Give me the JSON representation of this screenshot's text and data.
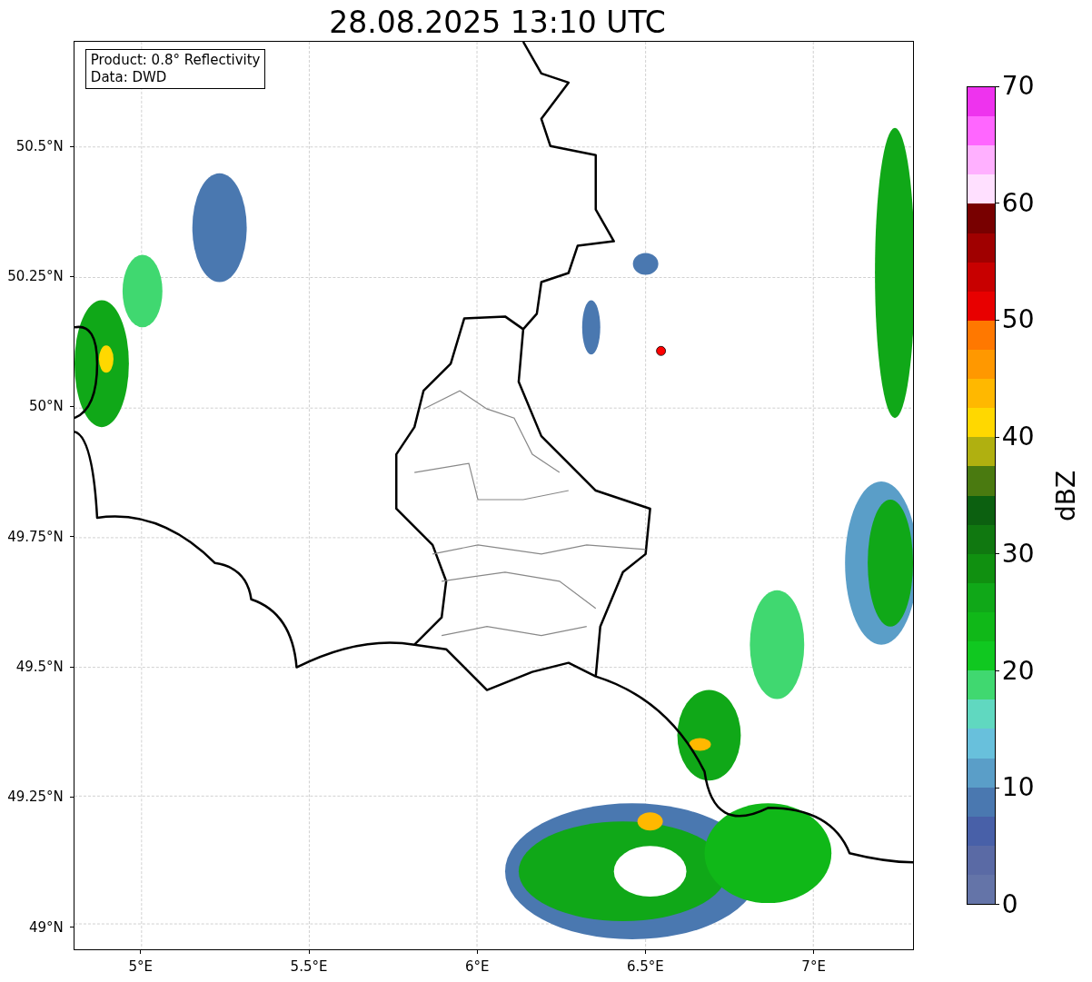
{
  "title": "28.08.2025 13:10 UTC",
  "info_box": {
    "lines": [
      "Product: 0.8° Reflectivity",
      "Data: DWD"
    ]
  },
  "map": {
    "y_ticks": [
      "50.5°N",
      "50.25°N",
      "50°N",
      "49.75°N",
      "49.5°N",
      "49.25°N",
      "49°N"
    ],
    "x_ticks": [
      "5°E",
      "5.5°E",
      "6°E",
      "6.5°E",
      "7°E"
    ]
  },
  "colorbar": {
    "label": "dBZ",
    "ticks": [
      "70",
      "60",
      "50",
      "40",
      "30",
      "20",
      "10",
      "0"
    ],
    "segments": [
      {
        "color": "#ee33ee"
      },
      {
        "color": "#ff66ff"
      },
      {
        "color": "#ffb0ff"
      },
      {
        "color": "#ffe0ff"
      },
      {
        "color": "#780000"
      },
      {
        "color": "#a00000"
      },
      {
        "color": "#c80000"
      },
      {
        "color": "#e80000"
      },
      {
        "color": "#ff7800"
      },
      {
        "color": "#ff9800"
      },
      {
        "color": "#ffb800"
      },
      {
        "color": "#ffd800"
      },
      {
        "color": "#b0b010"
      },
      {
        "color": "#4a7a10"
      },
      {
        "color": "#0c6010"
      },
      {
        "color": "#107810"
      },
      {
        "color": "#109010"
      },
      {
        "color": "#10a818"
      },
      {
        "color": "#10b818"
      },
      {
        "color": "#10c820"
      },
      {
        "color": "#40d870"
      },
      {
        "color": "#60d8c0"
      },
      {
        "color": "#68c0dc"
      },
      {
        "color": "#5a9ec8"
      },
      {
        "color": "#4a78b0"
      },
      {
        "color": "#4860a8"
      },
      {
        "color": "#5a6aa5"
      },
      {
        "color": "#6474a8"
      }
    ]
  }
}
